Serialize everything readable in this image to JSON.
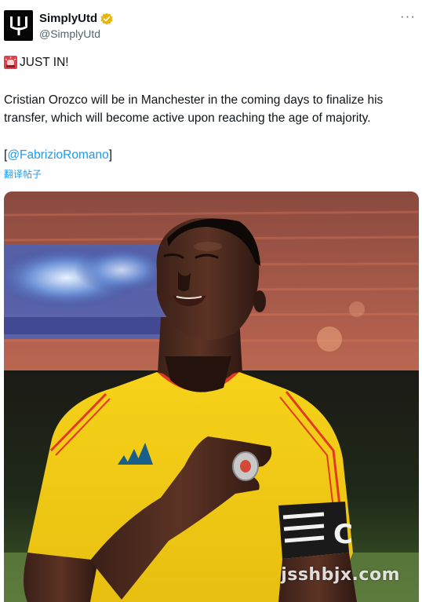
{
  "author": {
    "display_name": "SimplyUtd",
    "handle": "@SimplyUtd",
    "avatar_icon": "trident-logo-icon",
    "verified_color": "#e8b50d"
  },
  "tweet": {
    "headline": "JUST IN!",
    "body": "Cristian Orozco will be in Manchester in the coming days to finalize his transfer, which will become active upon reaching the age of majority.",
    "source_open": "[",
    "source_mention": "@FabrizioRomano",
    "source_close": "]",
    "translate_label": "翻译帖子"
  },
  "media": {
    "watermark": "jsshbjx.com",
    "jersey_color": "#f6d21a",
    "armband_letter": "C"
  },
  "colors": {
    "link": "#1d9bf0",
    "muted": "#536471"
  }
}
